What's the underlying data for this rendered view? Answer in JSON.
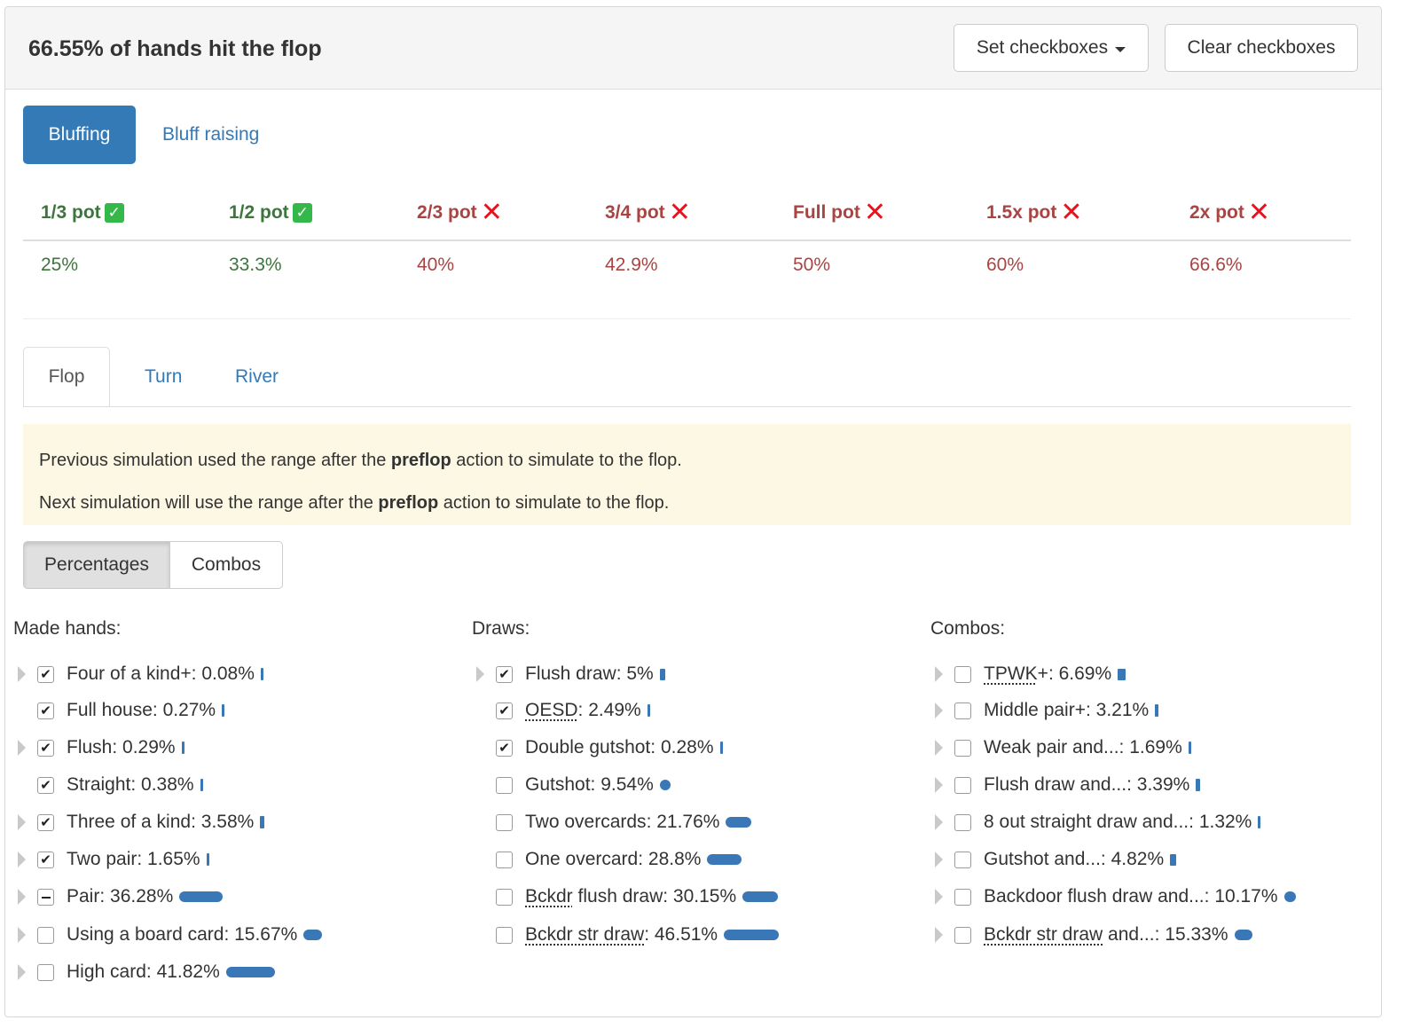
{
  "header": {
    "title": "66.55% of hands hit the flop",
    "set_checkboxes": "Set checkboxes",
    "clear_checkboxes": "Clear checkboxes"
  },
  "pills": {
    "active": "Bluffing",
    "other": "Bluff raising"
  },
  "pot_sizes": [
    {
      "label": "1/3 pot",
      "value": "25%",
      "ok": true
    },
    {
      "label": "1/2 pot",
      "value": "33.3%",
      "ok": true
    },
    {
      "label": "2/3 pot",
      "value": "40%",
      "ok": false
    },
    {
      "label": "3/4 pot",
      "value": "42.9%",
      "ok": false
    },
    {
      "label": "Full pot",
      "value": "50%",
      "ok": false
    },
    {
      "label": "1.5x pot",
      "value": "60%",
      "ok": false
    },
    {
      "label": "2x pot",
      "value": "66.6%",
      "ok": false
    }
  ],
  "street_tabs": {
    "active": "Flop",
    "turn": "Turn",
    "river": "River"
  },
  "alert": {
    "line1_pre": "Previous simulation used the range after the ",
    "line1_bold": "preflop",
    "line1_post": " action to simulate to the flop.",
    "line2_pre": "Next simulation will use the range after the ",
    "line2_bold": "preflop",
    "line2_post": " action to simulate to the flop."
  },
  "view_toggle": {
    "percentages": "Percentages",
    "combos": "Combos"
  },
  "columns": {
    "made_hands": {
      "title": "Made hands:",
      "items": [
        {
          "name": "Four of a kind+",
          "value": "0.08%",
          "state": "checked",
          "expandable": true,
          "bar_pct": 0.08
        },
        {
          "name": "Full house",
          "value": "0.27%",
          "state": "checked",
          "expandable": false,
          "bar_pct": 0.27
        },
        {
          "name": "Flush",
          "value": "0.29%",
          "state": "checked",
          "expandable": true,
          "bar_pct": 0.29
        },
        {
          "name": "Straight",
          "value": "0.38%",
          "state": "checked",
          "expandable": false,
          "bar_pct": 0.38
        },
        {
          "name": "Three of a kind",
          "value": "3.58%",
          "state": "checked",
          "expandable": true,
          "bar_pct": 3.58
        },
        {
          "name": "Two pair",
          "value": "1.65%",
          "state": "checked",
          "expandable": true,
          "bar_pct": 1.65
        },
        {
          "name": "Pair",
          "value": "36.28%",
          "state": "indeterminate",
          "expandable": true,
          "bar_pct": 36.28
        },
        {
          "name": "Using a board card",
          "value": "15.67%",
          "state": "unchecked",
          "expandable": true,
          "bar_pct": 15.67
        },
        {
          "name": "High card",
          "value": "41.82%",
          "state": "unchecked",
          "expandable": true,
          "bar_pct": 41.82
        }
      ]
    },
    "draws": {
      "title": "Draws:",
      "items": [
        {
          "name": "Flush draw",
          "value": "5%",
          "state": "checked",
          "expandable": true,
          "bar_pct": 5
        },
        {
          "name": "OESD",
          "abbr": true,
          "value": "2.49%",
          "state": "checked",
          "expandable": false,
          "bar_pct": 2.49
        },
        {
          "name": "Double gutshot",
          "value": "0.28%",
          "state": "checked",
          "expandable": false,
          "bar_pct": 0.28
        },
        {
          "name": "Gutshot",
          "value": "9.54%",
          "state": "unchecked",
          "expandable": false,
          "bar_pct": 9.54
        },
        {
          "name": "Two overcards",
          "value": "21.76%",
          "state": "unchecked",
          "expandable": false,
          "bar_pct": 21.76
        },
        {
          "name": "One overcard",
          "value": "28.8%",
          "state": "unchecked",
          "expandable": false,
          "bar_pct": 28.8
        },
        {
          "name": "Bckdr",
          "abbr": true,
          "suffix": " flush draw",
          "value": "30.15%",
          "state": "unchecked",
          "expandable": false,
          "bar_pct": 30.15
        },
        {
          "name": "Bckdr str draw",
          "abbr": true,
          "value": "46.51%",
          "state": "unchecked",
          "expandable": false,
          "bar_pct": 46.51
        }
      ]
    },
    "combos": {
      "title": "Combos:",
      "items": [
        {
          "name": "TPWK",
          "abbr": true,
          "suffix": "+",
          "value": "6.69%",
          "state": "unchecked",
          "expandable": true,
          "bar_pct": 6.69
        },
        {
          "name": "Middle pair+",
          "value": "3.21%",
          "state": "unchecked",
          "expandable": true,
          "bar_pct": 3.21
        },
        {
          "name": "Weak pair and...",
          "value": "1.69%",
          "state": "unchecked",
          "expandable": true,
          "bar_pct": 1.69
        },
        {
          "name": "Flush draw and...",
          "value": "3.39%",
          "state": "unchecked",
          "expandable": true,
          "bar_pct": 3.39
        },
        {
          "name": "8 out straight draw and...",
          "value": "1.32%",
          "state": "unchecked",
          "expandable": true,
          "bar_pct": 1.32
        },
        {
          "name": "Gutshot and...",
          "value": "4.82%",
          "state": "unchecked",
          "expandable": true,
          "bar_pct": 4.82
        },
        {
          "name": "Backdoor flush draw and...",
          "value": "10.17%",
          "state": "unchecked",
          "expandable": true,
          "bar_pct": 10.17
        },
        {
          "name": "Bckdr str draw",
          "abbr": true,
          "suffix": " and...",
          "value": "15.33%",
          "state": "unchecked",
          "expandable": true,
          "bar_pct": 15.33
        }
      ]
    }
  },
  "colors": {
    "primary": "#337ab7",
    "good": "#3c763d",
    "bad": "#a94442",
    "bar": "#3a77b6",
    "alert_bg": "#fcf8e3"
  }
}
